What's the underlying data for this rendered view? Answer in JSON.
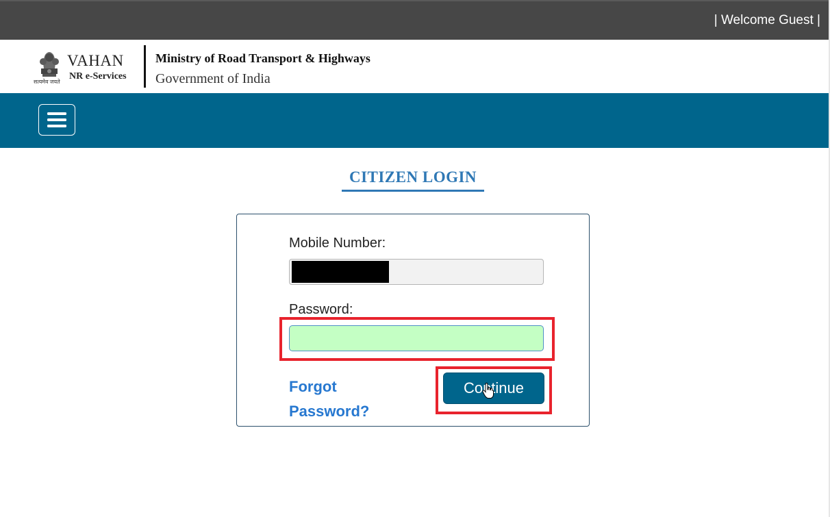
{
  "topbar": {
    "welcome": "| Welcome Guest |"
  },
  "header": {
    "brand_title": "VAHAN",
    "brand_subtitle": "NR e-Services",
    "brand_motto": "सत्यमेव जयते",
    "ministry": "Ministry of Road Transport & Highways",
    "government": "Government of India"
  },
  "navbar": {
    "menu_icon": "hamburger-menu-icon"
  },
  "login": {
    "title": "CITIZEN LOGIN",
    "mobile_label": "Mobile Number:",
    "mobile_value": "",
    "password_label": "Password:",
    "password_value": "",
    "forgot_label": "Forgot Password?",
    "continue_label": "Continue"
  },
  "colors": {
    "topbar": "#474747",
    "navbar": "#00658c",
    "title": "#2f78b5",
    "link": "#2778d0",
    "password_field": "#c4ffc4",
    "highlight": "#e8232d"
  }
}
